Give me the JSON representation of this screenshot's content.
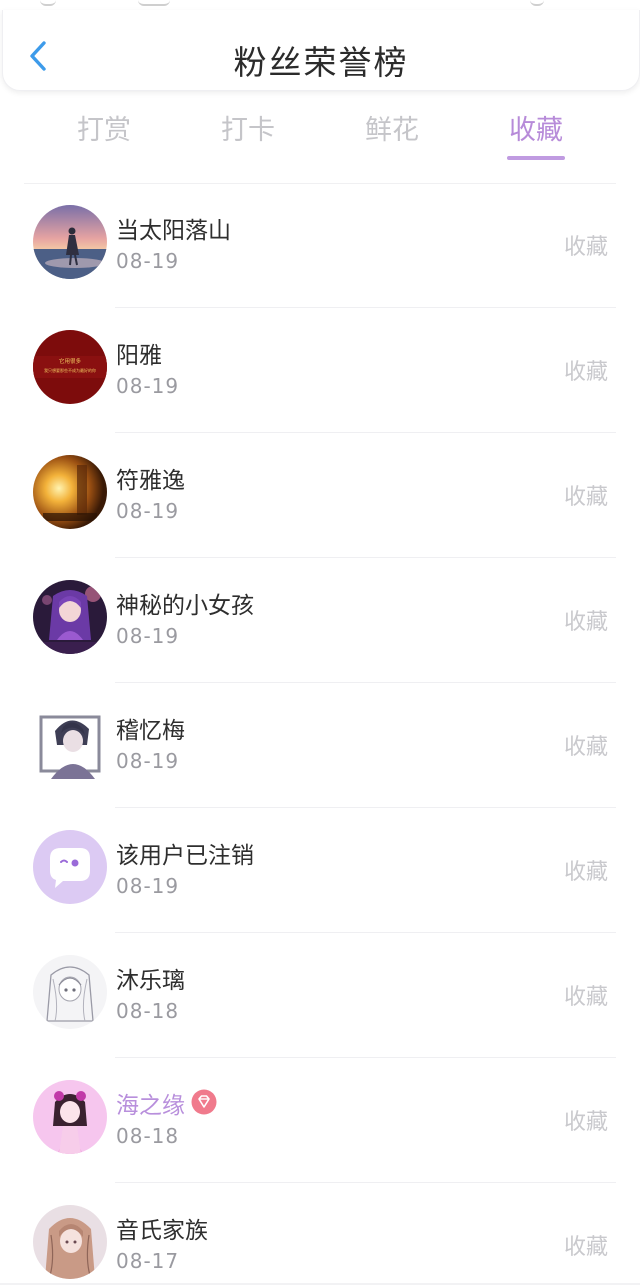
{
  "header": {
    "title": "粉丝荣誉榜"
  },
  "tabs": [
    {
      "label": "打赏",
      "active": false
    },
    {
      "label": "打卡",
      "active": false
    },
    {
      "label": "鲜花",
      "active": false
    },
    {
      "label": "收藏",
      "active": true
    }
  ],
  "colors": {
    "accent": "#b78bd9",
    "back_icon": "#3d9bea",
    "inactive_tab": "#c5c5c9",
    "vip_badge": "#f07a8c"
  },
  "list": [
    {
      "name": "当太阳落山",
      "date": "08-19",
      "action": "收藏",
      "avatar_icon": "sunset-avatar-icon"
    },
    {
      "name": "阳雅",
      "date": "08-19",
      "action": "收藏",
      "avatar_icon": "red-banner-avatar-icon",
      "avatar_text": [
        "它用很多",
        "我只想要那些不成为最好的你"
      ]
    },
    {
      "name": "符雅逸",
      "date": "08-19",
      "action": "收藏",
      "avatar_icon": "warm-light-avatar-icon"
    },
    {
      "name": "神秘的小女孩",
      "date": "08-19",
      "action": "收藏",
      "avatar_icon": "anime-girl-avatar-icon"
    },
    {
      "name": "稽忆梅",
      "date": "08-19",
      "action": "收藏",
      "avatar_icon": "anime-boy-avatar-icon"
    },
    {
      "name": "该用户已注销",
      "date": "08-19",
      "action": "收藏",
      "avatar_icon": "chat-bubble-avatar-icon"
    },
    {
      "name": "沐乐璃",
      "date": "08-18",
      "action": "收藏",
      "avatar_icon": "sketch-girl-avatar-icon"
    },
    {
      "name": "海之缘",
      "date": "08-18",
      "action": "收藏",
      "avatar_icon": "pink-doll-avatar-icon",
      "highlight": true,
      "badge_icon": "diamond-badge-icon"
    },
    {
      "name": "音氏家族",
      "date": "08-17",
      "action": "收藏",
      "avatar_icon": "blonde-girl-avatar-icon"
    }
  ]
}
